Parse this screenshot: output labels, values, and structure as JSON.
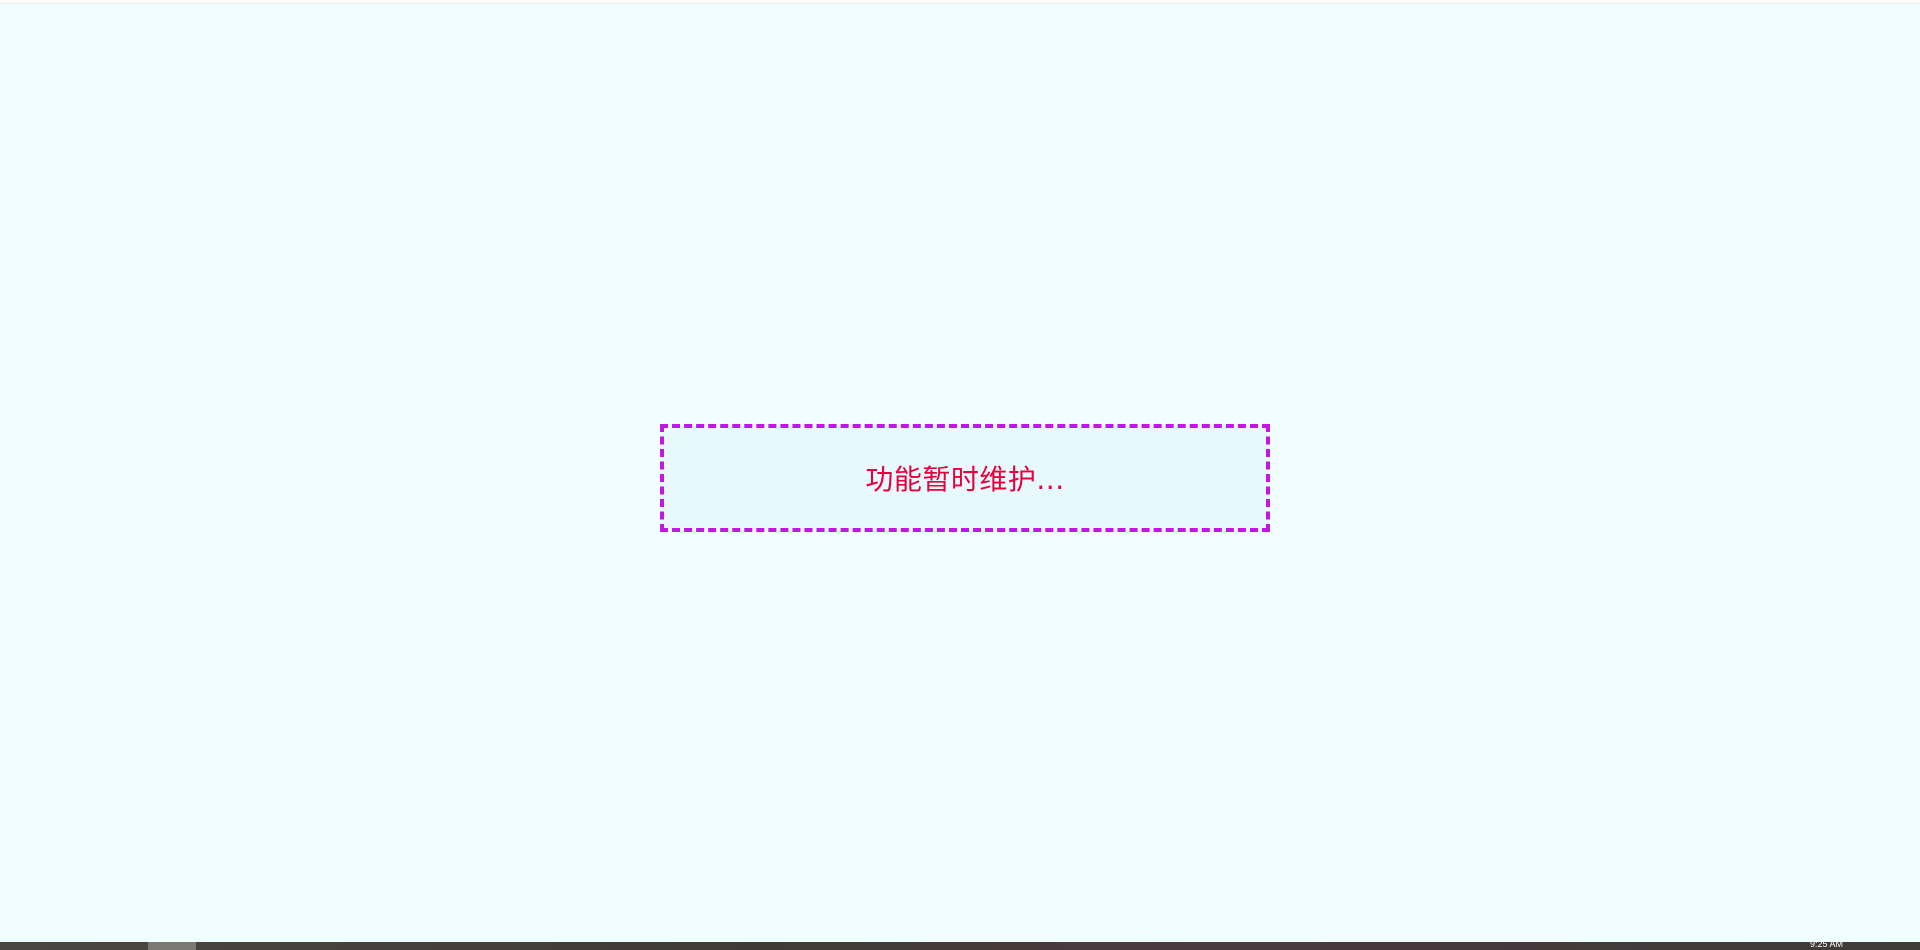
{
  "page": {
    "message": "功能暂时维护..."
  },
  "taskbar": {
    "clock": "9:25 AM"
  },
  "colors": {
    "background": "#f0feff",
    "box_border": "#c416e3",
    "box_fill": "#e7f9fd",
    "message_text": "#e8003d",
    "taskbar": "#3f3a37"
  }
}
